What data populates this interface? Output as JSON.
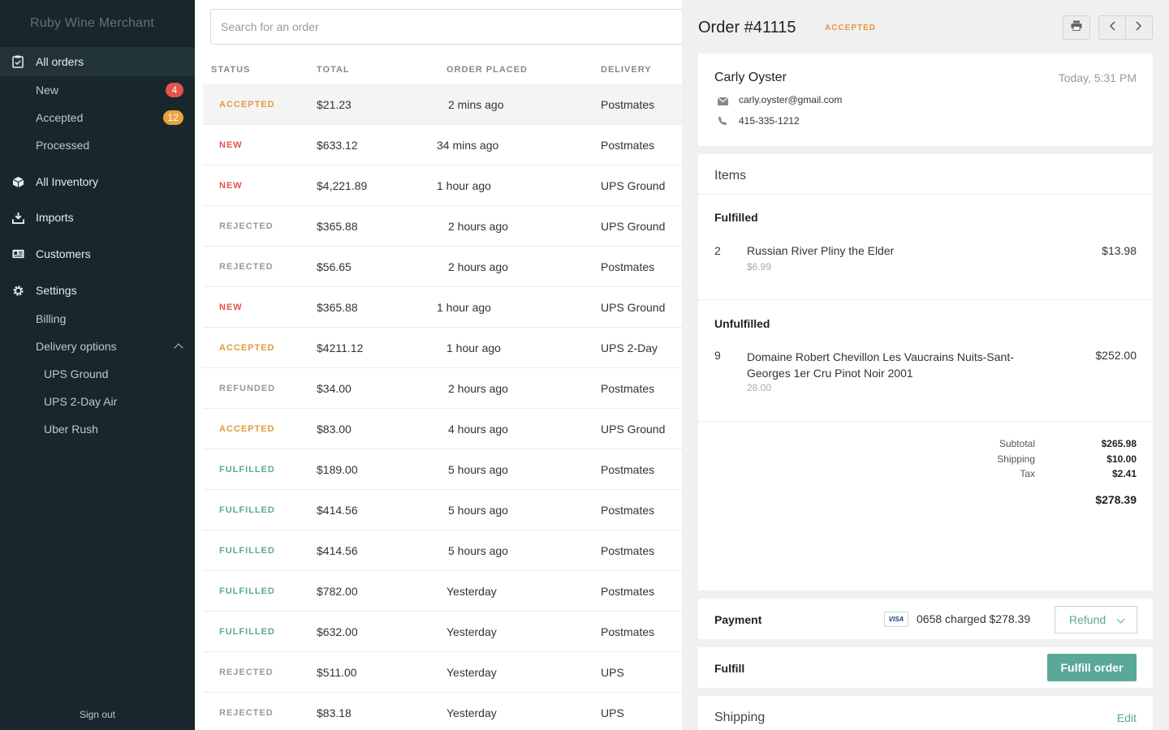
{
  "sidebar": {
    "brand": "Ruby Wine Merchant",
    "all_orders": "All orders",
    "new": {
      "label": "New",
      "count": "4"
    },
    "accepted": {
      "label": "Accepted",
      "count": "12"
    },
    "processed": "Processed",
    "all_inventory": "All Inventory",
    "imports": "Imports",
    "customers": "Customers",
    "settings": "Settings",
    "billing": "Billing",
    "delivery_options": "Delivery options",
    "delivery_items": [
      "UPS Ground",
      "UPS 2-Day Air",
      "Uber Rush"
    ],
    "sign_out": "Sign out"
  },
  "orders": {
    "search_placeholder": "Search for an order",
    "columns": [
      "STATUS",
      "TOTAL",
      "ORDER PLACED",
      "DELIVERY"
    ],
    "rows": [
      {
        "status": "ACCEPTED",
        "total": "$21.23",
        "placed": "2 mins ago",
        "delivery": "Postmates"
      },
      {
        "status": "NEW",
        "total": "$633.12",
        "placed": "34 mins ago",
        "delivery": "Postmates"
      },
      {
        "status": "NEW",
        "total": "$4,221.89",
        "placed": "1 hour ago",
        "delivery": "UPS Ground"
      },
      {
        "status": "REJECTED",
        "total": "$365.88",
        "placed": "2 hours ago",
        "delivery": "UPS Ground"
      },
      {
        "status": "REJECTED",
        "total": "$56.65",
        "placed": "2 hours ago",
        "delivery": "Postmates"
      },
      {
        "status": "NEW",
        "total": "$365.88",
        "placed": "1 hour ago",
        "delivery": "UPS Ground"
      },
      {
        "status": "ACCEPTED",
        "total": "$4211.12",
        "placed": "1 hour ago",
        "delivery": "UPS 2-Day"
      },
      {
        "status": "REFUNDED",
        "total": "$34.00",
        "placed": "2 hours ago",
        "delivery": "Postmates"
      },
      {
        "status": "ACCEPTED",
        "total": "$83.00",
        "placed": "4 hours ago",
        "delivery": "UPS Ground"
      },
      {
        "status": "FULFILLED",
        "total": "$189.00",
        "placed": "5 hours ago",
        "delivery": "Postmates"
      },
      {
        "status": "FULFILLED",
        "total": "$414.56",
        "placed": "5 hours ago",
        "delivery": "Postmates"
      },
      {
        "status": "FULFILLED",
        "total": "$414.56",
        "placed": "5 hours ago",
        "delivery": "Postmates"
      },
      {
        "status": "FULFILLED",
        "total": "$782.00",
        "placed": "Yesterday",
        "delivery": "Postmates"
      },
      {
        "status": "FULFILLED",
        "total": "$632.00",
        "placed": "Yesterday",
        "delivery": "Postmates"
      },
      {
        "status": "REJECTED",
        "total": "$511.00",
        "placed": "Yesterday",
        "delivery": "UPS"
      },
      {
        "status": "REJECTED",
        "total": "$83.18",
        "placed": "Yesterday",
        "delivery": "UPS"
      }
    ],
    "status_colors": {
      "ACCEPTED": "#e29a3b",
      "NEW": "#e5534b",
      "REJECTED": "#999999",
      "REFUNDED": "#999999",
      "FULFILLED": "#5aa898"
    }
  },
  "detail": {
    "title": "Order #41115",
    "status": "ACCEPTED",
    "customer": {
      "name": "Carly Oyster",
      "placed": "Today, 5:31 PM",
      "email": "carly.oyster@gmail.com",
      "phone": "415-335-1212"
    },
    "items_heading": "Items",
    "fulfilled_heading": "Fulfilled",
    "fulfilled": [
      {
        "qty": "2",
        "name": "Russian River Pliny the Elder",
        "unit": "$6.99",
        "price": "$13.98"
      }
    ],
    "unfulfilled_heading": "Unfulfilled",
    "unfulfilled": [
      {
        "qty": "9",
        "name": "Domaine Robert Chevillon Les Vaucrains Nuits-Sant-Georges 1er Cru Pinot Noir 2001",
        "unit": "28.00",
        "price": "$252.00"
      }
    ],
    "totals": {
      "subtotal_label": "Subtotal",
      "subtotal": "$265.98",
      "shipping_label": "Shipping",
      "shipping": "$10.00",
      "tax_label": "Tax",
      "tax": "$2.41",
      "total": "$278.39"
    },
    "payment": {
      "label": "Payment",
      "card": "VISA",
      "charged": "0658 charged $278.39",
      "refund_label": "Refund"
    },
    "fulfill": {
      "label": "Fulfill",
      "button": "Fulfill order"
    },
    "shipping": {
      "label": "Shipping",
      "edit": "Edit"
    }
  }
}
